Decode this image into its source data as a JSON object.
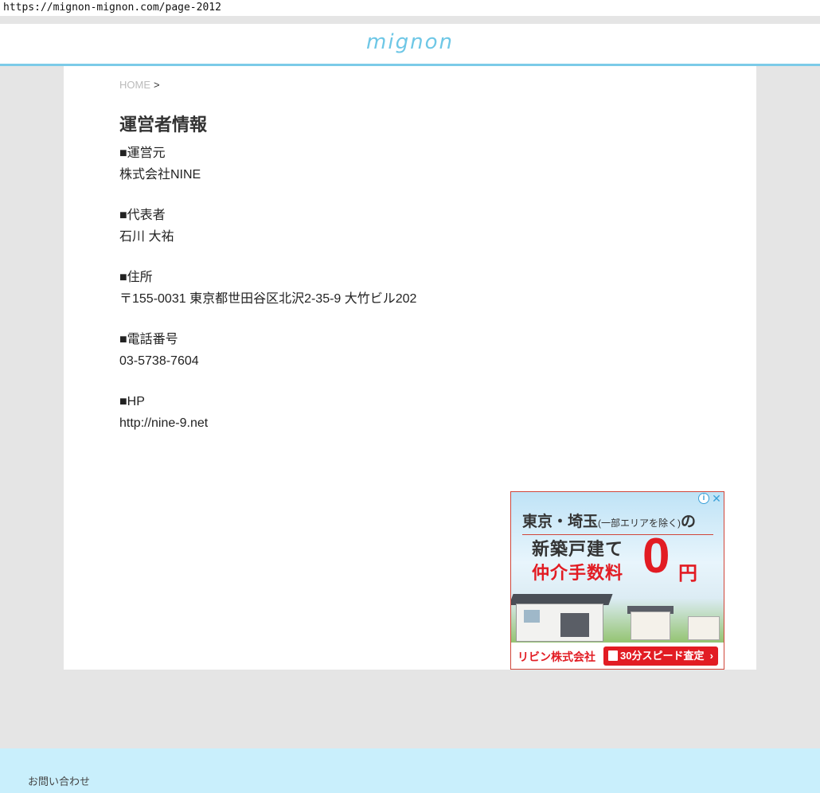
{
  "browser": {
    "url": "https://mignon-mignon.com/page-2012"
  },
  "header": {
    "logo": "mignon"
  },
  "breadcrumb": {
    "home": "HOME",
    "separator": ">"
  },
  "page": {
    "title": "運営者情報",
    "sections": [
      {
        "label": "■運営元",
        "value": "株式会社NINE"
      },
      {
        "label": "■代表者",
        "value": "石川 大祐"
      },
      {
        "label": "■住所",
        "value": "〒155-0031 東京都世田谷区北沢2-35-9 大竹ビル202"
      },
      {
        "label": "■電話番号",
        "value": "03-5738-7604"
      },
      {
        "label": "■HP",
        "value": "http://nine-9.net"
      }
    ]
  },
  "ad": {
    "info_icon": "i",
    "close_icon": "✕",
    "headline": "東京・埼玉",
    "headline_note": "(一部エリアを除く)",
    "headline_suffix": "の",
    "line2": "新築戸建て",
    "line3": "仲介手数料",
    "zero": "0",
    "yen": "円",
    "brand": "リビン株式会社",
    "cta": "30分スピード査定",
    "cta_arrow": "›"
  },
  "footer": {
    "contact": "お問い合わせ"
  },
  "colors": {
    "accent": "#7ccbe8",
    "footer_bg": "#c9effc",
    "page_bg": "#e5e5e5",
    "ad_red": "#e21c23"
  }
}
